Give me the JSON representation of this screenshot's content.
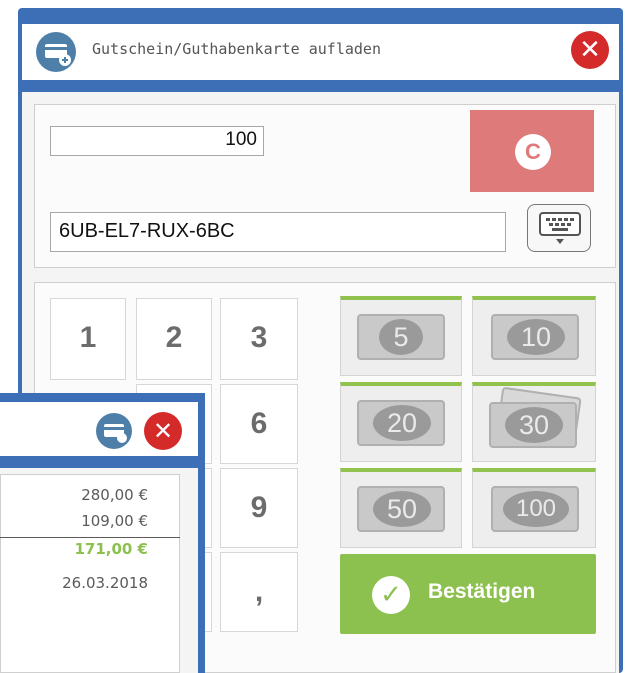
{
  "dialog": {
    "title": "Gutschein/Guthabenkarte aufladen",
    "close_icon": "close-icon",
    "amount_value": "100",
    "clear_label": "C",
    "code_value": "6UB-EL7-RUX-6BC",
    "keyboard_icon": "keyboard-icon"
  },
  "keypad": {
    "keys": [
      "1",
      "2",
      "3",
      "6",
      "9",
      ","
    ]
  },
  "bills": [
    "5",
    "10",
    "20",
    "30",
    "50",
    "100"
  ],
  "confirm": {
    "label": "Bestätigen",
    "icon": "check-circle-icon"
  },
  "background_window": {
    "values": [
      "280,00 €",
      "109,00 €",
      "171,00 €",
      "26.03.2018"
    ],
    "highlight_color": "#8cc04f"
  },
  "colors": {
    "frame_blue": "#3c6fb5",
    "clear_red": "#df7a7a",
    "confirm_green": "#8cc04f",
    "close_red": "#d42a2a"
  }
}
